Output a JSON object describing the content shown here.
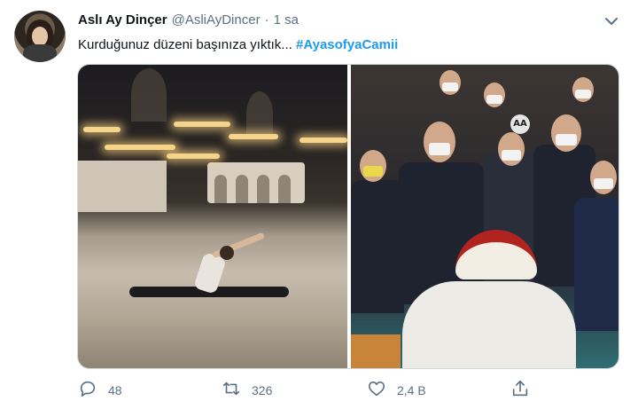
{
  "tweet": {
    "author": {
      "name": "Aslı Ay Dinçer",
      "handle": "@AsliAyDincer",
      "separator": "·",
      "time": "1 sa"
    },
    "text": "Kurduğunuz düzeni başınıza yıktık...",
    "hashtag": "#AyasofyaCamii",
    "media": {
      "right_image_badge": "AA"
    },
    "actions": {
      "reply": {
        "icon": "reply-icon",
        "count": "48"
      },
      "retweet": {
        "icon": "retweet-icon",
        "count": "326"
      },
      "like": {
        "icon": "heart-icon",
        "count": "2,4 B"
      },
      "share": {
        "icon": "share-icon"
      }
    },
    "menu_icon": "chevron-down-icon"
  },
  "colors": {
    "hashtag": "#1d9bf0",
    "secondary_text": "#5b7083",
    "primary_text": "#0f1419",
    "border": "#cfd9de"
  }
}
